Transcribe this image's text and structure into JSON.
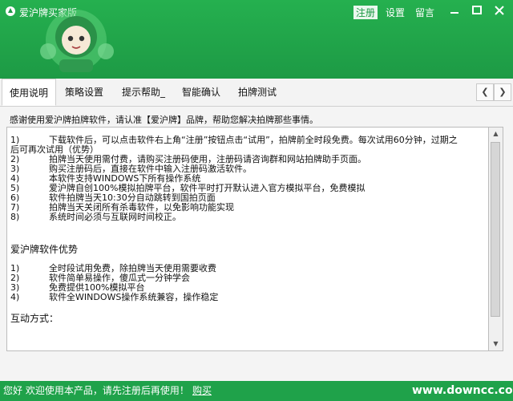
{
  "app": {
    "title": "爱沪牌买家版",
    "nav": [
      "注册",
      "设置",
      "留言"
    ],
    "window_controls": {
      "minimize": "—",
      "maximize": "□",
      "close": "✕"
    }
  },
  "tabs": [
    "使用说明",
    "策略设置",
    "提示帮助_",
    "智能确认",
    "拍牌测试"
  ],
  "active_tab": "使用说明",
  "content": {
    "intro": "感谢使用爱沪牌拍牌软件，请认准【爱沪牌】品牌，帮助您解决拍牌那些事情。",
    "steps": [
      {
        "num": "1)",
        "text": "下载软件后，可以点击软件右上角“注册”按钮点击“试用”，拍牌前全时段免费。每次试用60分钟，过期之"
      },
      {
        "num": "",
        "text": "后可再次试用（优势）"
      },
      {
        "num": "2)",
        "text": "拍牌当天使用需付费，请购买注册码使用，注册码请咨询群和网站拍牌助手页面。"
      },
      {
        "num": "3)",
        "text": "购买注册码后，直接在软件中输入注册码激活软件。"
      },
      {
        "num": "4)",
        "text": "本软件支持WINDOWS下所有操作系统"
      },
      {
        "num": "5)",
        "text": "爱沪牌自创100%模拟拍牌平台，软件平时打开默认进入官方模拟平台，免费模拟"
      },
      {
        "num": "6)",
        "text": "软件拍牌当天10:30分自动跳转到国拍页面"
      },
      {
        "num": "7)",
        "text": "拍牌当天关闭所有杀毒软件，以免影响功能实现"
      },
      {
        "num": "8)",
        "text": "系统时间必须与互联网时间校正。"
      }
    ],
    "advantages_title": "爱沪牌软件优势",
    "advantages": [
      {
        "num": "1)",
        "text": "全时段试用免费，除拍牌当天使用需要收费"
      },
      {
        "num": "2)",
        "text": "软件简单易操作，傻瓜式一分钟学会"
      },
      {
        "num": "3)",
        "text": "免费提供100%模拟平台"
      },
      {
        "num": "4)",
        "text": "软件全WINDOWS操作系统兼容，操作稳定"
      }
    ],
    "interaction_title": "互动方式："
  },
  "status": {
    "text": "您好 欢迎使用本产品，请先注册后再使用！",
    "link": "购买",
    "watermark": "www.downcc.com"
  },
  "colors": {
    "brand_green": "#1fa24a",
    "accent_white": "#ffffff"
  },
  "icons": [
    "app-logo-icon",
    "mascot-icon",
    "chevron-left-icon",
    "chevron-right-icon",
    "scroll-up-icon",
    "scroll-down-icon"
  ]
}
